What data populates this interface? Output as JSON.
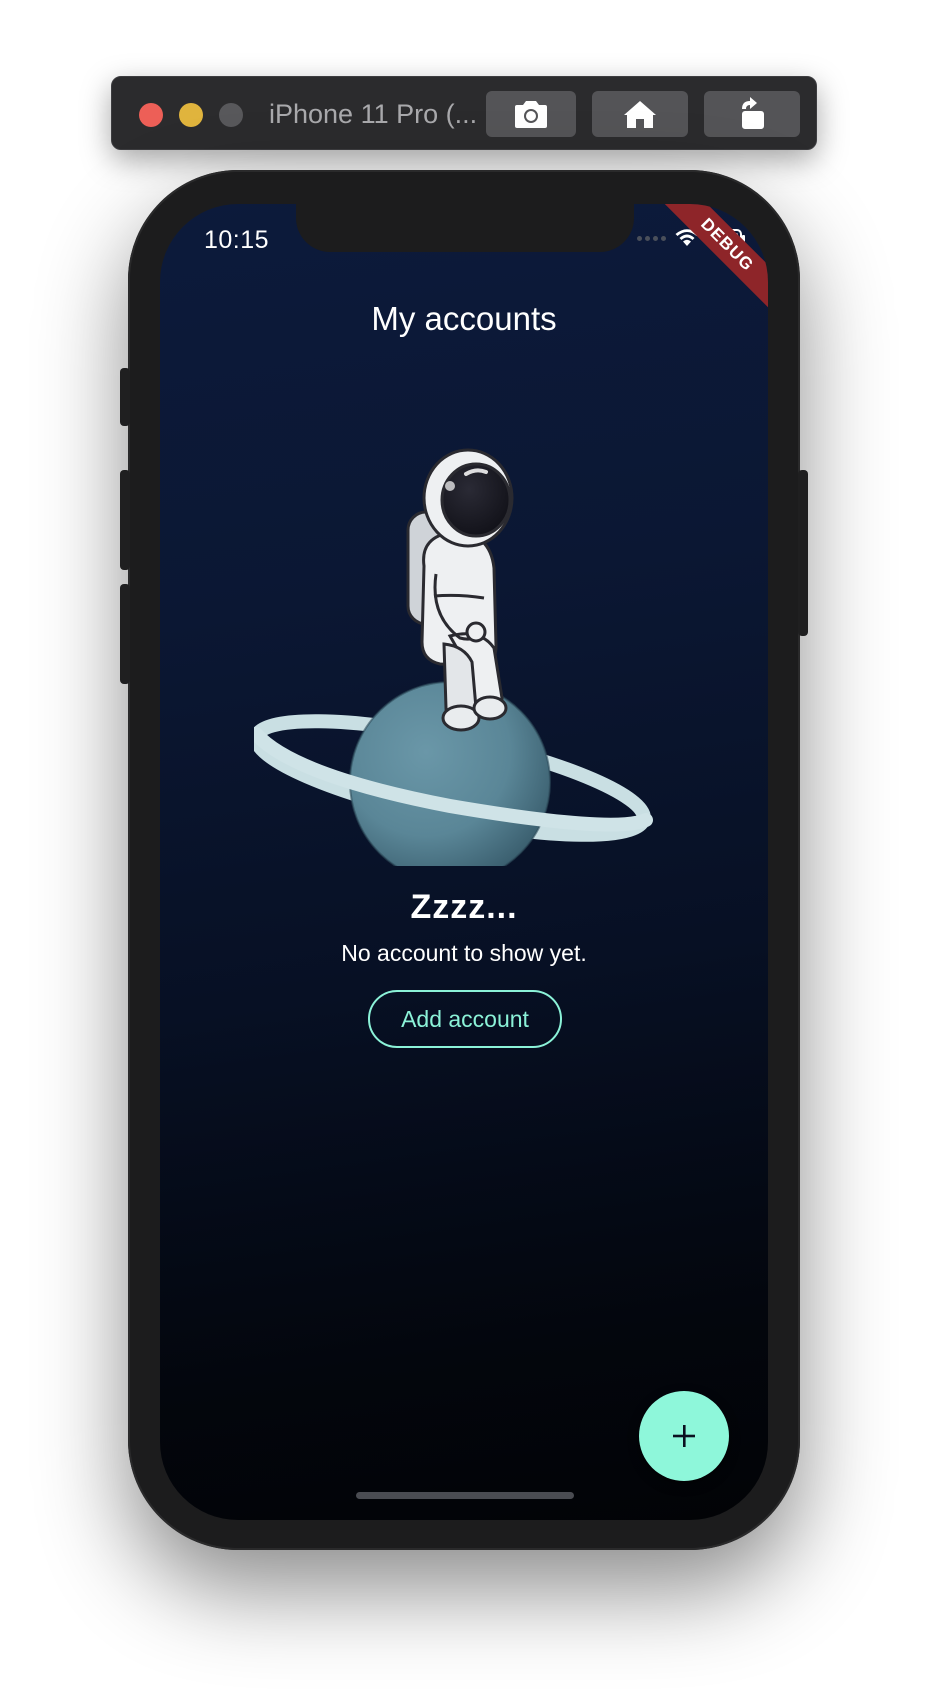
{
  "simulator": {
    "title": "iPhone 11 Pro (...",
    "buttons": [
      "screenshot-icon",
      "home-icon",
      "rotate-icon"
    ]
  },
  "status_bar": {
    "time": "10:15",
    "debug_banner": "DEBUG"
  },
  "header": {
    "title": "My accounts"
  },
  "empty_state": {
    "illustration": "astronaut-on-planet",
    "title": "Zzzz...",
    "message": "No account to show yet.",
    "action_label": "Add account"
  },
  "fab": {
    "icon": "plus-icon",
    "label": "+"
  },
  "colors": {
    "accent": "#8ef7da",
    "outline": "#8bf2d8",
    "background_top": "#0c1a3b",
    "background_bottom": "#020306",
    "debug_banner": "#8e2529"
  }
}
